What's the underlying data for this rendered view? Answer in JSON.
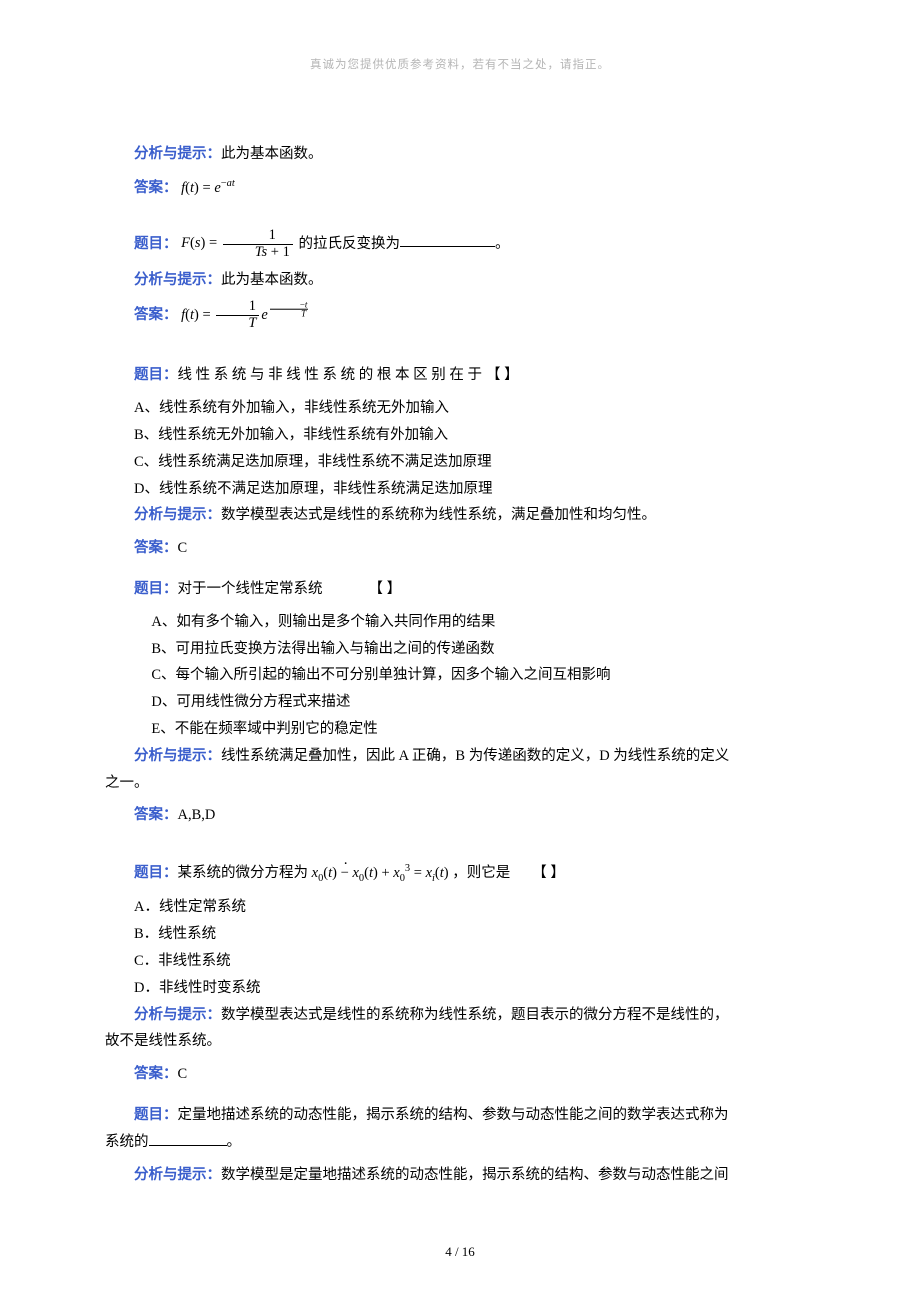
{
  "header": {
    "tagline": "真诚为您提供优质参考资料，若有不当之处，请指正。"
  },
  "sections": [
    {
      "kind": "hint",
      "label": "分析与提示：",
      "text": "此为基本函数。"
    },
    {
      "kind": "answer",
      "label": "答案：",
      "formula_prefix": "f(t) = ",
      "formula_desc": "e^{-at}"
    },
    {
      "kind": "question",
      "label": "题目：",
      "formula_prefix": "F(s) = ",
      "formula_desc": "1 / (Ts + 1)",
      "tail": " 的拉氏反变换为",
      "blank": true,
      "trailing": "。"
    },
    {
      "kind": "hint",
      "label": "分析与提示：",
      "text": "此为基本函数。"
    },
    {
      "kind": "answer",
      "label": "答案：",
      "formula_prefix": "f(t) = ",
      "formula_desc": "(1/T) e^{-t/T}"
    },
    {
      "kind": "question",
      "label": "题目：",
      "text_spaced": "线 性 系 统 与 非 线 性 系 统 的 根 本 区 别 在 于",
      "bracket": "【   】",
      "options": [
        "A、线性系统有外加输入，非线性系统无外加输入",
        "B、线性系统无外加输入，非线性系统有外加输入",
        "C、线性系统满足迭加原理，非线性系统不满足迭加原理",
        "D、线性系统不满足迭加原理，非线性系统满足迭加原理"
      ]
    },
    {
      "kind": "hint",
      "label": "分析与提示：",
      "text": "数学模型表达式是线性的系统称为线性系统，满足叠加性和均匀性。"
    },
    {
      "kind": "answer_plain",
      "label": "答案：",
      "text": "C"
    },
    {
      "kind": "question",
      "label": "题目：",
      "text": "对于一个线性定常系统",
      "bracket": "【     】",
      "options_mono": [
        "A、如有多个输入，则输出是多个输入共同作用的结果",
        "B、可用拉氏变换方法得出输入与输出之间的传递函数",
        "C、每个输入所引起的输出不可分别单独计算，因多个输入之间互相影响",
        "D、可用线性微分方程式来描述",
        "E、不能在频率域中判别它的稳定性"
      ]
    },
    {
      "kind": "hint_wrap",
      "label": "分析与提示：",
      "text1": "线性系统满足叠加性，因此 A 正确，B 为传递函数的定义，D 为线性系统的定义",
      "text2": "之一。"
    },
    {
      "kind": "answer_plain",
      "label": "答案：",
      "text": "A,B,D"
    },
    {
      "kind": "question",
      "label": "题目：",
      "lead": "某系统的微分方程为",
      "eq_desc": "ẋ₀(t) − x₀(t) + x₀³ = xᵢ(t)",
      "mid": "，则它是",
      "bracket": "【        】",
      "options_dot": [
        "A．线性定常系统",
        "B．线性系统",
        "C．非线性系统",
        "D．非线性时变系统"
      ]
    },
    {
      "kind": "hint_wrap",
      "label": "分析与提示：",
      "text1": "数学模型表达式是线性的系统称为线性系统，题目表示的微分方程不是线性的，",
      "text2": "故不是线性系统。"
    },
    {
      "kind": "answer_plain",
      "label": "答案：",
      "text": "C"
    },
    {
      "kind": "question_wrap",
      "label": "题目：",
      "text1": "定量地描述系统的动态性能，揭示系统的结构、参数与动态性能之间的数学表达式称为",
      "text2_pre": "系统的",
      "blank": true,
      "trailing": "。"
    },
    {
      "kind": "hint",
      "label": "分析与提示：",
      "text": "数学模型是定量地描述系统的动态性能，揭示系统的结构、参数与动态性能之间"
    }
  ],
  "footer": {
    "page": "4 / 16"
  }
}
